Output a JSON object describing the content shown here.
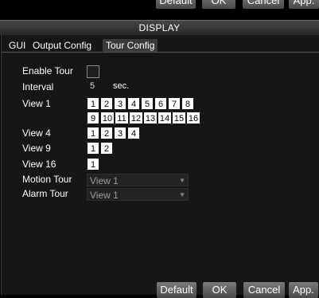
{
  "topbar": {
    "buttons": [
      "Default",
      "OK",
      "Cancel",
      "App."
    ]
  },
  "window": {
    "title": "DISPLAY"
  },
  "tabs": [
    "GUI",
    "Output Config",
    "Tour Config"
  ],
  "form": {
    "enable_tour_label": "Enable Tour",
    "interval_label": "Interval",
    "interval_value": "5",
    "interval_unit": "sec.",
    "view1_label": "View 1",
    "view4_label": "View 4",
    "view9_label": "View 9",
    "view16_label": "View 16",
    "motion_tour_label": "Motion Tour",
    "motion_tour_value": "View 1",
    "alarm_tour_label": "Alarm Tour",
    "alarm_tour_value": "View 1"
  },
  "view1_numbers_row1": [
    "1",
    "2",
    "3",
    "4",
    "5",
    "6",
    "7",
    "8"
  ],
  "view1_numbers_row2": [
    "9",
    "10",
    "11",
    "12",
    "13",
    "14",
    "15",
    "16"
  ],
  "view4_numbers": [
    "1",
    "2",
    "3",
    "4"
  ],
  "view9_numbers": [
    "1",
    "2"
  ],
  "view16_numbers": [
    "1"
  ],
  "footer": {
    "buttons": [
      "Default",
      "OK",
      "Cancel",
      "App."
    ]
  }
}
